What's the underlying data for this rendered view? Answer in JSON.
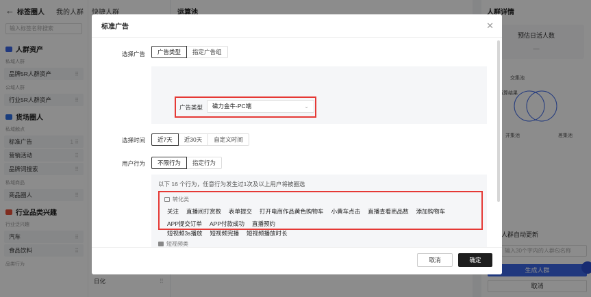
{
  "app": {
    "back_icon": "arrow-left-icon",
    "tabs": [
      "标签圈人",
      "我的人群",
      "快捷人群"
    ],
    "search_placeholder": "输入标签名称搜索",
    "groups": [
      {
        "title": "人群资产",
        "color": "#3b66e6"
      },
      {
        "title": "货场圈人",
        "color": "#2f6fe3"
      },
      {
        "title": "行业品类兴趣",
        "color": "#e8503a"
      }
    ],
    "sub_labels": [
      "私域人群",
      "公域人群",
      "私域触点",
      "私域商品",
      "行业泛兴趣",
      "品类行为"
    ],
    "rows": [
      "品牌5R人群资产",
      "行业5R人群资产",
      "标准广告",
      "营销活动",
      "品牌词搜索",
      "商品圈人",
      "汽车",
      "食品饮料"
    ],
    "row_suffix": "1",
    "col2_item": "日化",
    "center_title": "运算池",
    "right_title": "人群详情",
    "daily_title": "预估日活人数",
    "daily_value": "—",
    "legend": [
      "交集池",
      "运算结果",
      "并集池",
      "差集池"
    ],
    "auto_update": "人群自动更新",
    "name_placeholder": "输入30个字内的人群包名称",
    "generate_btn": "生成人群",
    "cancel_btn": "取消"
  },
  "modal": {
    "title": "标准广告",
    "close_icon": "close-icon",
    "select_ad_label": "选择广告",
    "ad_tabs": [
      "广告类型",
      "指定广告组"
    ],
    "ad_type_label": "广告类型",
    "ad_type_value": "磁力金牛-PC端",
    "select_time_label": "选择时间",
    "time_tabs": [
      "近7天",
      "近30天",
      "自定义时间"
    ],
    "user_behavior_label": "用户行为",
    "behavior_tabs": [
      "不限行为",
      "指定行为"
    ],
    "hint": "以下 16 个行为，任意行为发生过1次及以上用户将被圈选",
    "categories": [
      {
        "name": "转化类",
        "items": [
          "关注",
          "直播间打赏数",
          "表单提交",
          "打开电商作品黄色购物车",
          "小黄车点击",
          "直播查看商品数",
          "添加购物车",
          "APP提交订单",
          "APP付款成功",
          "直播预约"
        ]
      },
      {
        "name": "短视频类",
        "items": [
          "短视频3s播放",
          "短视频完播",
          "短视频播放时长"
        ]
      }
    ],
    "cancel": "取消",
    "confirm": "确定"
  }
}
